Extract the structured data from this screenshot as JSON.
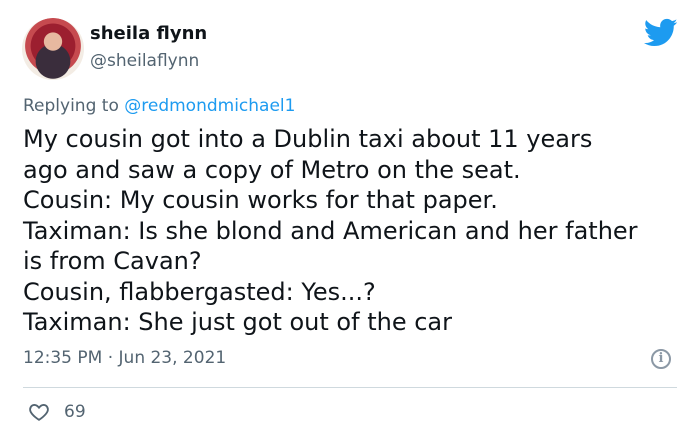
{
  "author": {
    "name": "sheila flynn",
    "handle": "@sheilaflynn"
  },
  "reply": {
    "prefix": "Replying to",
    "mention": "@redmondmichael1"
  },
  "tweet_lines": [
    "My cousin got into a Dublin taxi about 11 years",
    "ago and saw a copy of Metro on the seat.",
    "Cousin: My cousin works for that paper.",
    "Taximan: Is she blond and American and her father",
    "is from Cavan?",
    "Cousin, flabbergasted: Yes...?",
    "Taximan: She just got out of the car"
  ],
  "timestamp": "12:35 PM · Jun 23, 2021",
  "likes": "69",
  "colors": {
    "brand": "#1d9bf0",
    "text": "#0f1419",
    "muted": "#536471",
    "divider": "#cfd9de"
  },
  "icons": {
    "logo": "twitter-bird-icon",
    "info": "info-icon",
    "like": "heart-icon"
  }
}
